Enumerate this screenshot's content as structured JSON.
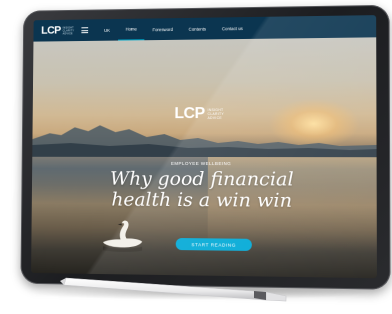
{
  "navbar": {
    "logo": {
      "mark": "LCP",
      "tagline": [
        "INSIGHT",
        "CLARITY",
        "ADVICE"
      ]
    },
    "menu_icon": "hamburger-menu-icon",
    "items": [
      {
        "label": "UK",
        "active": false
      },
      {
        "label": "Home",
        "active": true
      },
      {
        "label": "Foresword",
        "active": false
      },
      {
        "label": "Contents",
        "active": false
      },
      {
        "label": "Contact us",
        "active": false
      }
    ]
  },
  "hero": {
    "logo": {
      "mark": "LCP",
      "tagline": [
        "INSIGHT",
        "CLARITY",
        "ADVICE"
      ]
    },
    "eyebrow": "EMPLOYEE WELLBEING",
    "headline_line1": "Why good financial",
    "headline_line2": "health is a win win",
    "cta_label": "START READING"
  },
  "colors": {
    "navbar_bg": "#0b3550",
    "accent": "#00a9d6",
    "active_underline": "#00a7c8"
  }
}
